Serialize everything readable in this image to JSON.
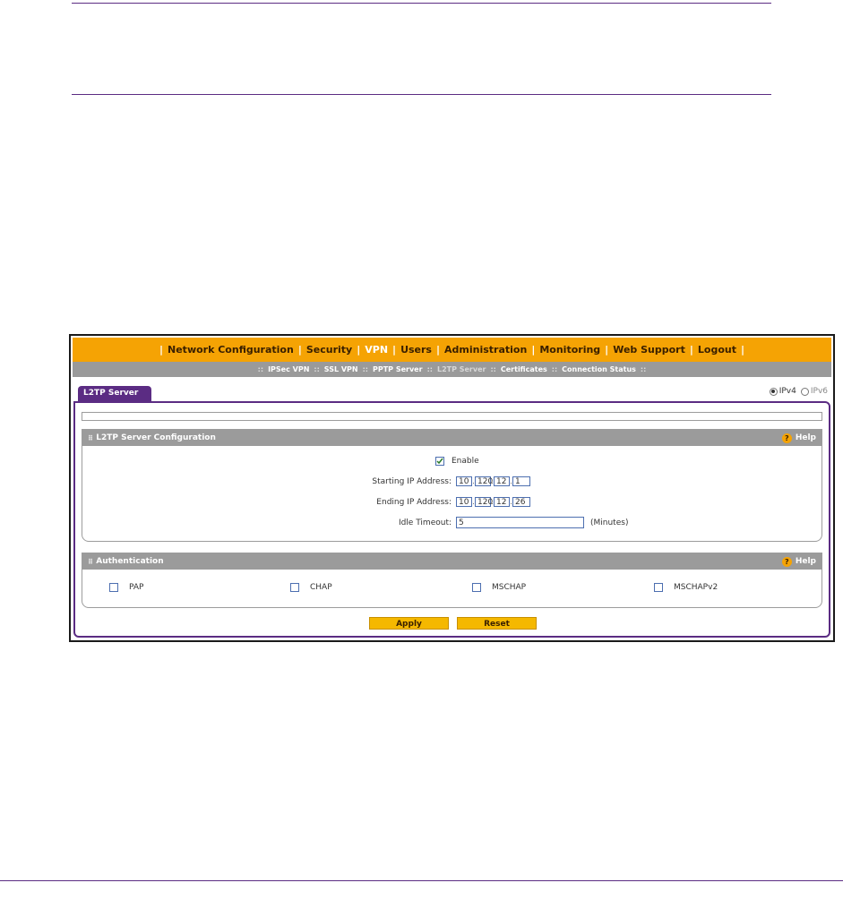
{
  "top_nav": {
    "items": [
      {
        "label": "Network Configuration",
        "active": false
      },
      {
        "label": "Security",
        "active": false
      },
      {
        "label": "VPN",
        "active": true
      },
      {
        "label": "Users",
        "active": false
      },
      {
        "label": "Administration",
        "active": false
      },
      {
        "label": "Monitoring",
        "active": false
      },
      {
        "label": "Web Support",
        "active": false
      },
      {
        "label": "Logout",
        "active": false
      }
    ]
  },
  "sub_nav": {
    "items": [
      {
        "label": "IPSec VPN",
        "active": false
      },
      {
        "label": "SSL VPN",
        "active": false
      },
      {
        "label": "PPTP Server",
        "active": false
      },
      {
        "label": "L2TP Server",
        "active": true
      },
      {
        "label": "Certificates",
        "active": false
      },
      {
        "label": "Connection Status",
        "active": false
      }
    ]
  },
  "tab": {
    "label": "L2TP Server"
  },
  "ip_version": {
    "ipv4": "IPv4",
    "ipv6": "IPv6",
    "selected": "IPv4"
  },
  "config_section": {
    "title": "L2TP Server Configuration",
    "help": "Help",
    "enable_label": "Enable",
    "enable_checked": true,
    "starting_ip_label": "Starting IP Address:",
    "starting_ip": [
      "10",
      "120",
      "12",
      "1"
    ],
    "ending_ip_label": "Ending IP Address:",
    "ending_ip": [
      "10",
      "120",
      "12",
      "26"
    ],
    "idle_timeout_label": "Idle Timeout:",
    "idle_timeout_value": "5",
    "idle_timeout_unit": "(Minutes)"
  },
  "auth_section": {
    "title": "Authentication",
    "help": "Help",
    "options": [
      {
        "label": "PAP",
        "checked": false
      },
      {
        "label": "CHAP",
        "checked": false
      },
      {
        "label": "MSCHAP",
        "checked": false
      },
      {
        "label": "MSCHAPv2",
        "checked": false
      }
    ]
  },
  "buttons": {
    "apply": "Apply",
    "reset": "Reset"
  },
  "colors": {
    "accent_orange": "#f5a304",
    "purple": "#5b2c83",
    "gray_bar": "#9b9b9b"
  }
}
